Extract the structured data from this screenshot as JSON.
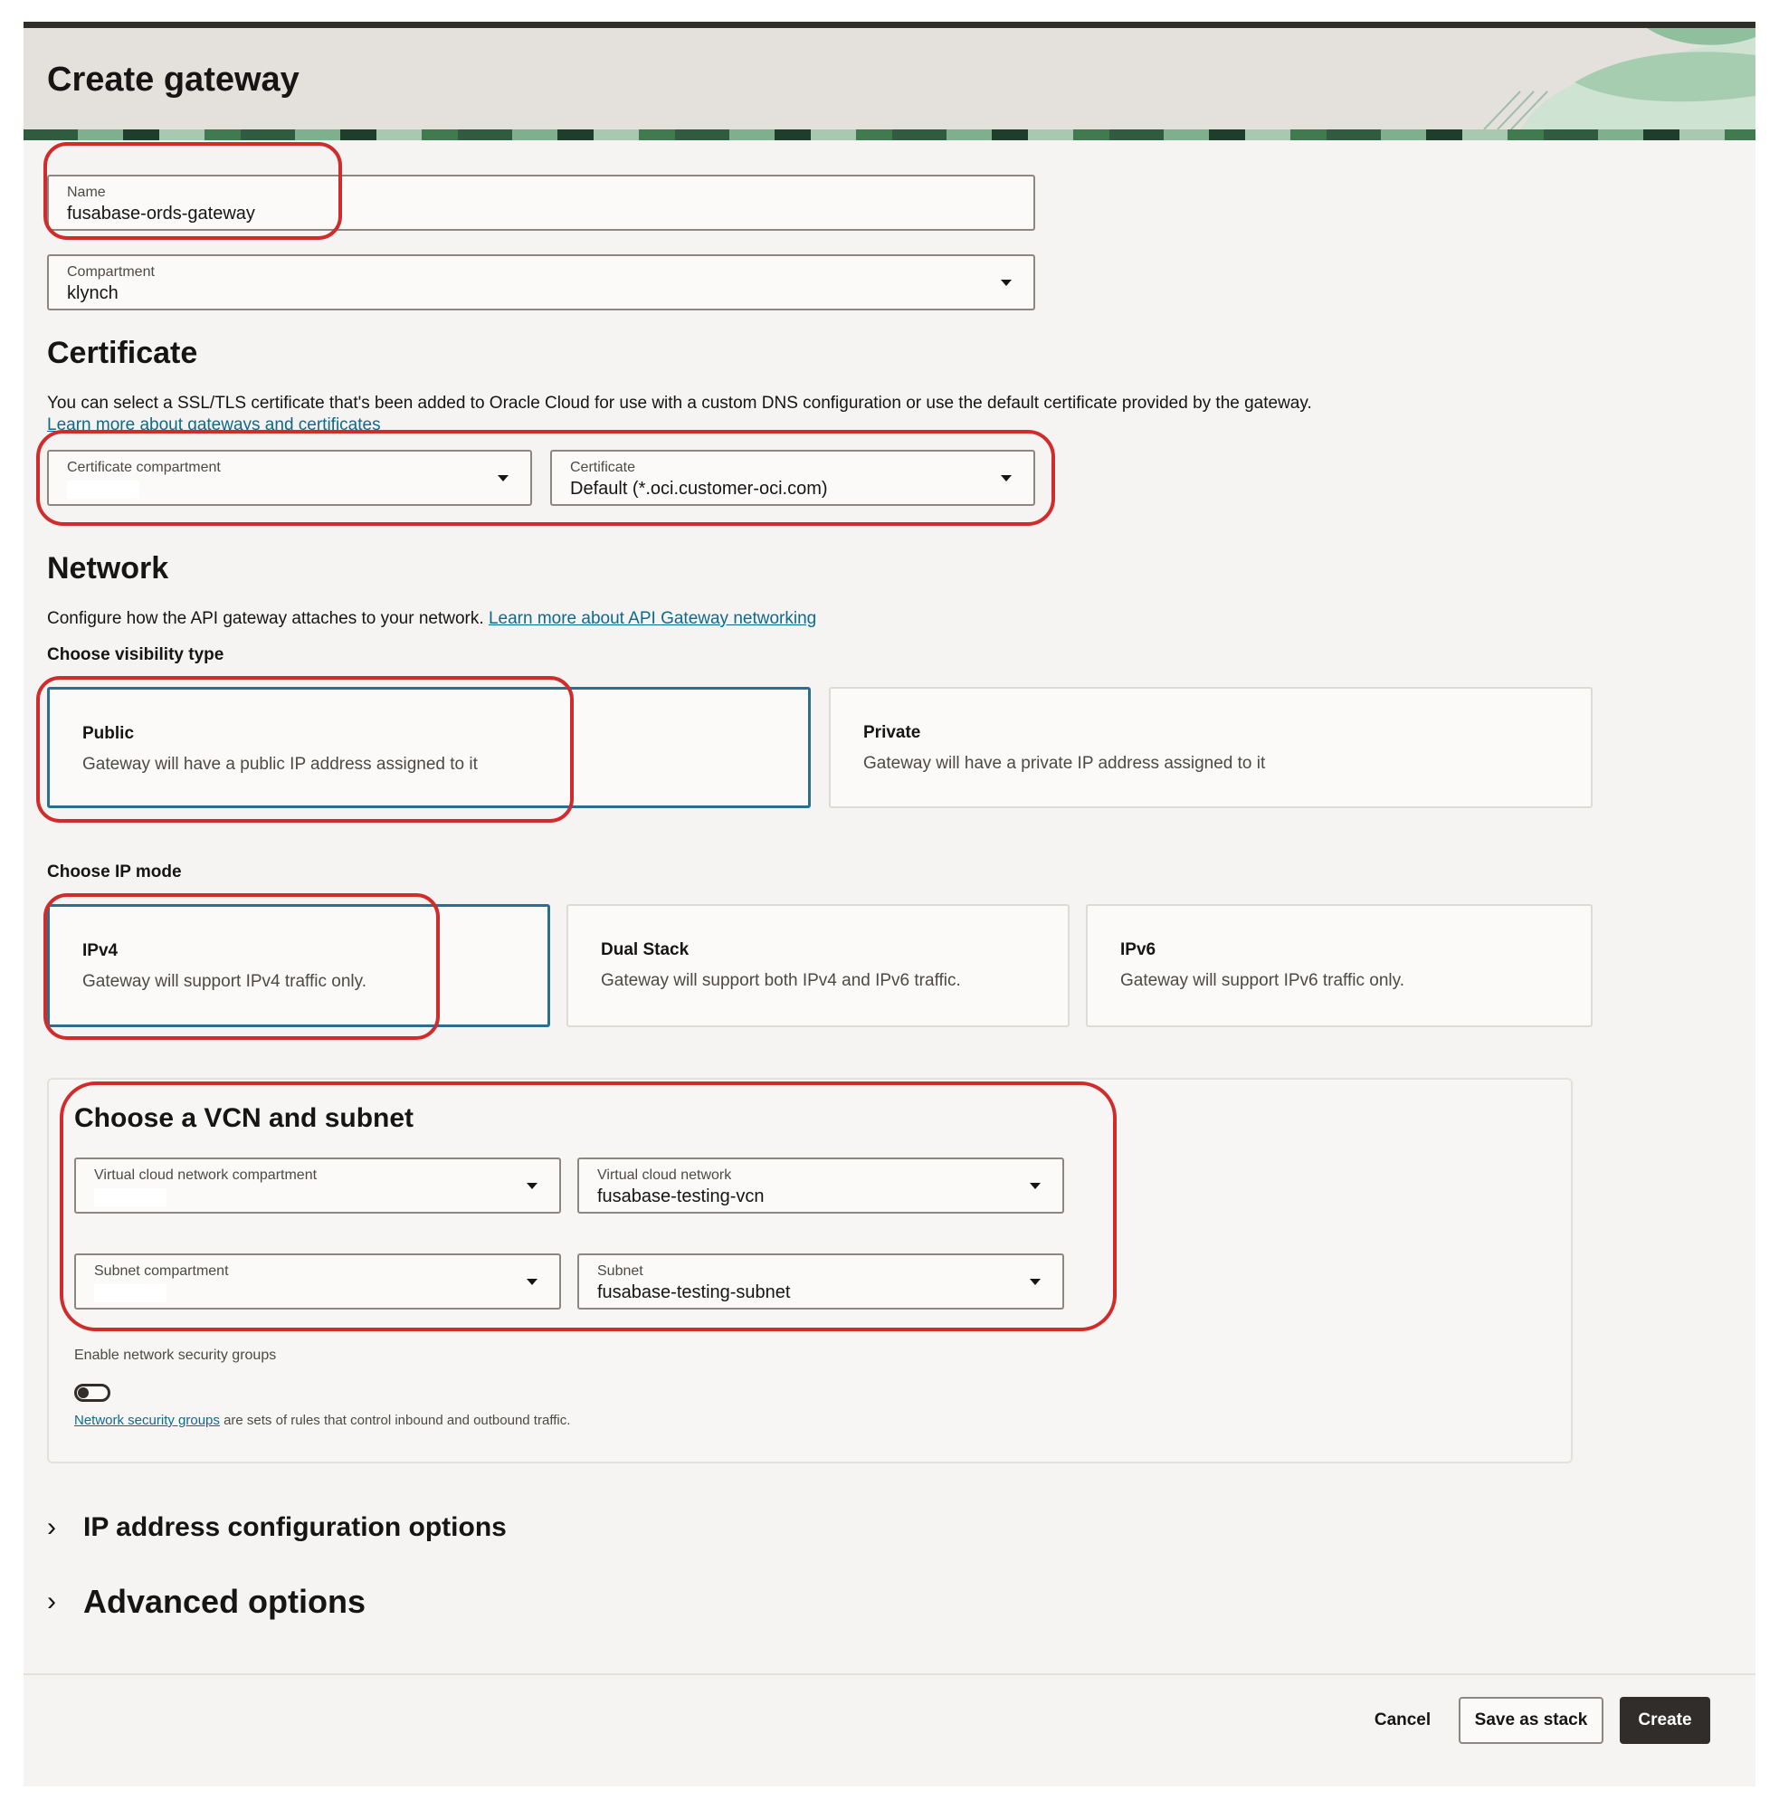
{
  "page": {
    "title": "Create gateway"
  },
  "name_field": {
    "label": "Name",
    "value": "fusabase-ords-gateway"
  },
  "compartment_field": {
    "label": "Compartment",
    "value": "klynch"
  },
  "certificate": {
    "heading": "Certificate",
    "description": "You can select a SSL/TLS certificate that's been added to Oracle Cloud for use with a custom DNS configuration or use the default certificate provided by the gateway.",
    "learn_more": "Learn more about gateways and certificates",
    "compartment_label": "Certificate compartment",
    "compartment_value": "",
    "cert_label": "Certificate",
    "cert_value": "Default (*.oci.customer-oci.com)"
  },
  "network": {
    "heading": "Network",
    "description": "Configure how the API gateway attaches to your network.",
    "learn_more": "Learn more about API Gateway networking",
    "visibility_label": "Choose visibility type",
    "visibility_options": [
      {
        "title": "Public",
        "desc": "Gateway will have a public IP address assigned to it",
        "selected": true
      },
      {
        "title": "Private",
        "desc": "Gateway will have a private IP address assigned to it",
        "selected": false
      }
    ],
    "ip_mode_label": "Choose IP mode",
    "ip_modes": [
      {
        "title": "IPv4",
        "desc": "Gateway will support IPv4 traffic only.",
        "selected": true
      },
      {
        "title": "Dual Stack",
        "desc": "Gateway will support both IPv4 and IPv6 traffic.",
        "selected": false
      },
      {
        "title": "IPv6",
        "desc": "Gateway will support IPv6 traffic only.",
        "selected": false
      }
    ]
  },
  "vcn": {
    "heading": "Choose a VCN and subnet",
    "vcn_compartment_label": "Virtual cloud network compartment",
    "vcn_compartment_value": "",
    "vcn_label": "Virtual cloud network",
    "vcn_value": "fusabase-testing-vcn",
    "subnet_compartment_label": "Subnet compartment",
    "subnet_compartment_value": "",
    "subnet_label": "Subnet",
    "subnet_value": "fusabase-testing-subnet",
    "nsg_label": "Enable network security groups",
    "nsg_enabled": false,
    "nsg_link": "Network security groups",
    "nsg_text": " are sets of rules that control inbound and outbound traffic."
  },
  "expanders": {
    "ip_config": "IP address configuration options",
    "advanced": "Advanced options"
  },
  "footer": {
    "cancel": "Cancel",
    "save_stack": "Save as stack",
    "create": "Create"
  },
  "colors": {
    "accent": "#2d6e8e",
    "annotation": "#d22b2b",
    "primary_button": "#312d2a",
    "link": "#0d6a8f"
  }
}
